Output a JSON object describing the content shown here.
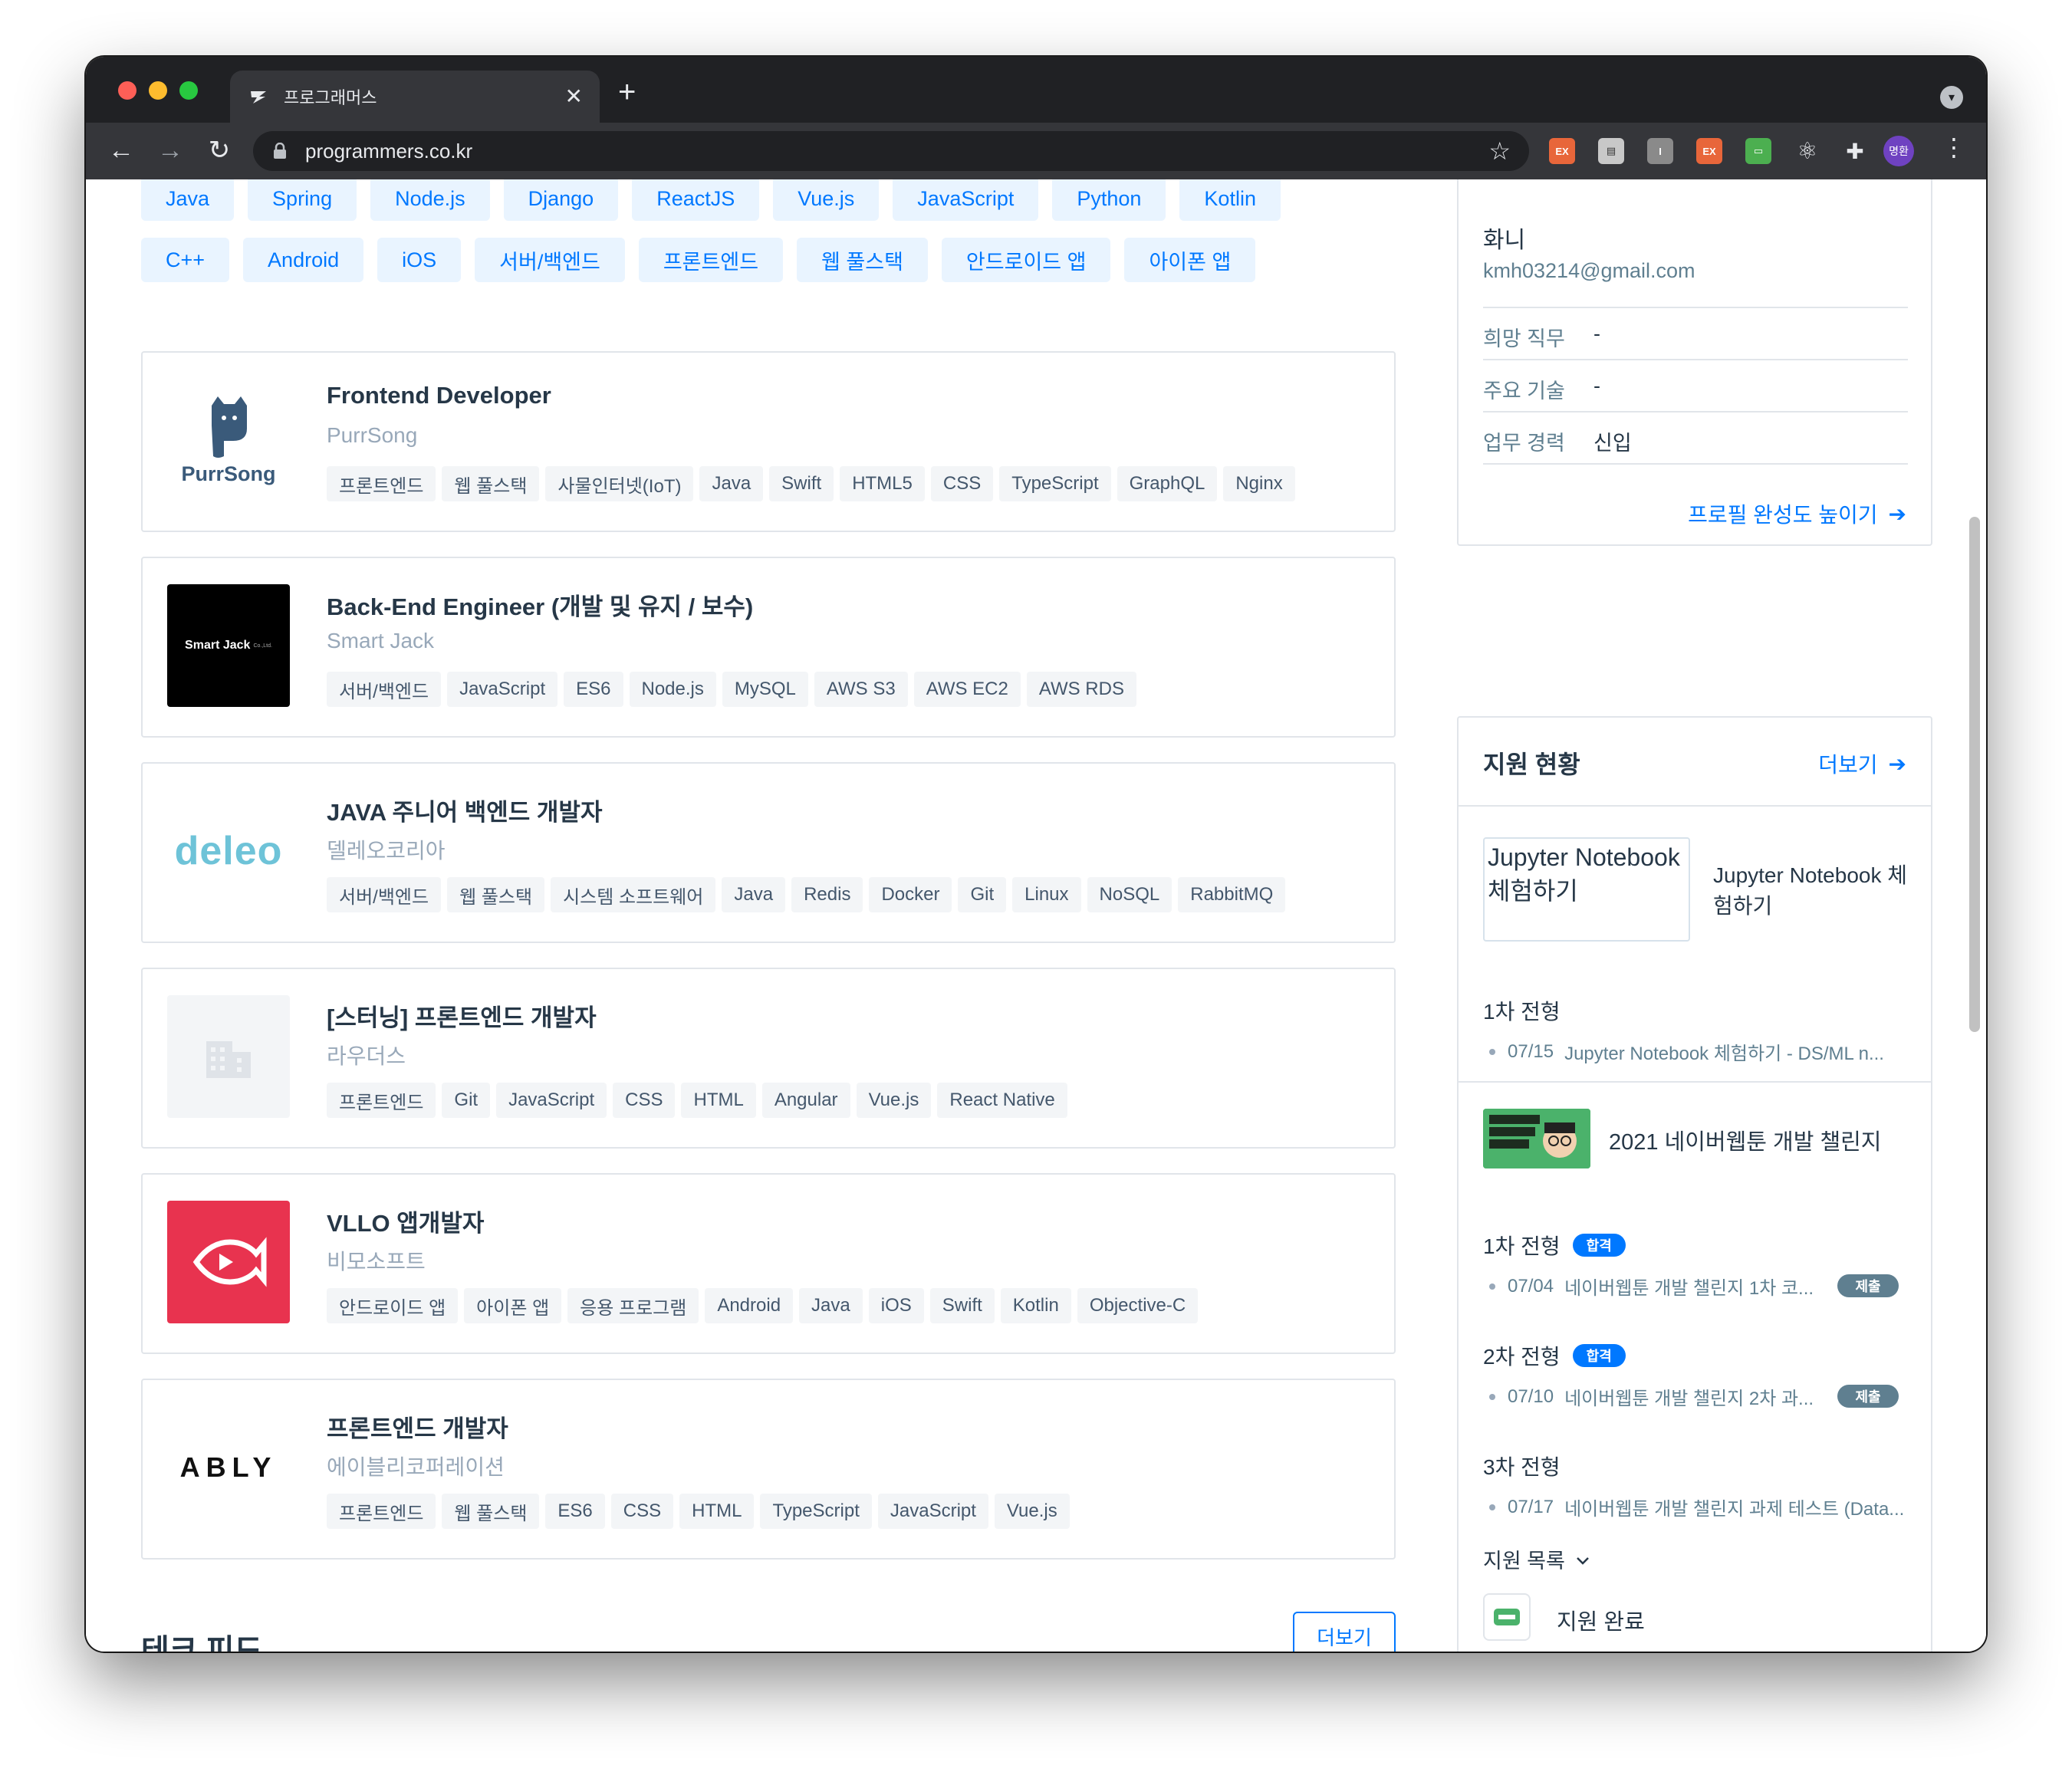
{
  "browser": {
    "tab_title": "프로그래머스",
    "url": "programmers.co.kr",
    "avatar_label": "명환",
    "extensions": [
      "EX",
      "folder",
      "I",
      "EX",
      "screen",
      "react",
      "puzzle"
    ]
  },
  "chip_rows": [
    [
      "Java",
      "Spring",
      "Node.js",
      "Django",
      "ReactJS",
      "Vue.js",
      "JavaScript",
      "Python",
      "Kotlin"
    ],
    [
      "C++",
      "Android",
      "iOS",
      "서버/백엔드",
      "프론트엔드",
      "웹 풀스택",
      "안드로이드 앱",
      "아이폰 앱"
    ]
  ],
  "jobs": [
    {
      "title": "Frontend Developer",
      "company": "PurrSong",
      "logo_text": "PurrSong",
      "tags": [
        "프론트엔드",
        "웹 풀스택",
        "사물인터넷(IoT)",
        "Java",
        "Swift",
        "HTML5",
        "CSS",
        "TypeScript",
        "GraphQL",
        "Nginx"
      ]
    },
    {
      "title": "Back-End Engineer (개발 및 유지 / 보수)",
      "company": "Smart Jack",
      "logo_text": "Smart Jack",
      "logo_sub": "Co.,Ltd.",
      "tags": [
        "서버/백엔드",
        "JavaScript",
        "ES6",
        "Node.js",
        "MySQL",
        "AWS S3",
        "AWS EC2",
        "AWS RDS"
      ]
    },
    {
      "title": "JAVA 주니어 백엔드 개발자",
      "company": "델레오코리아",
      "logo_text": "deleo",
      "tags": [
        "서버/백엔드",
        "웹 풀스택",
        "시스템 소프트웨어",
        "Java",
        "Redis",
        "Docker",
        "Git",
        "Linux",
        "NoSQL",
        "RabbitMQ"
      ]
    },
    {
      "title": "[스터닝] 프론트엔드 개발자",
      "company": "라우더스",
      "logo_text": "",
      "tags": [
        "프론트엔드",
        "Git",
        "JavaScript",
        "CSS",
        "HTML",
        "Angular",
        "Vue.js",
        "React Native"
      ]
    },
    {
      "title": "VLLO 앱개발자",
      "company": "비모소프트",
      "logo_text": "",
      "tags": [
        "안드로이드 앱",
        "아이폰 앱",
        "응용 프로그램",
        "Android",
        "Java",
        "iOS",
        "Swift",
        "Kotlin",
        "Objective-C"
      ]
    },
    {
      "title": "프론트엔드 개발자",
      "company": "에이블리코퍼레이션",
      "logo_text": "ABLY",
      "tags": [
        "프론트엔드",
        "웹 풀스택",
        "ES6",
        "CSS",
        "HTML",
        "TypeScript",
        "JavaScript",
        "Vue.js"
      ]
    }
  ],
  "tech_feed": {
    "title": "테크 피드",
    "more_label": "더보기"
  },
  "profile": {
    "name": "화니",
    "email": "kmh03214@gmail.com",
    "rows": [
      {
        "label": "희망 직무",
        "value": "-"
      },
      {
        "label": "주요 기술",
        "value": "-"
      },
      {
        "label": "업무 경력",
        "value": "신입"
      }
    ],
    "improve_link": "프로필 완성도 높이기"
  },
  "applications": {
    "title": "지원 현황",
    "more_label": "더보기",
    "jupyter": {
      "thumb_alt": "Jupyter Notebook 체험하기",
      "title": "Jupyter Notebook 체험하기",
      "stage": "1차 전형",
      "item_date": "07/15",
      "item_text": "Jupyter Notebook 체험하기 - DS/ML n..."
    },
    "naver": {
      "thumb_text": "네이버웹툰 개발 챌린지",
      "title": "2021 네이버웹툰 개발 챌린지",
      "stages": [
        {
          "name": "1차 전형",
          "badge": "합격",
          "date": "07/04",
          "text": "네이버웹툰 개발 챌린지 1차 코...",
          "status": "제출"
        },
        {
          "name": "2차 전형",
          "badge": "합격",
          "date": "07/10",
          "text": "네이버웹툰 개발 챌린지 2차 과...",
          "status": "제출"
        },
        {
          "name": "3차 전형",
          "badge": "",
          "date": "07/17",
          "text": "네이버웹툰 개발 챌린지 과제 테스트 (Data...",
          "status": ""
        }
      ]
    },
    "list_toggle": "지원 목록",
    "done_label": "지원 완료"
  },
  "colors": {
    "accent": "#0078ff",
    "chip_bg": "#e9f4ff",
    "tag_bg": "#f3f5f7",
    "border": "#e1e5ea"
  }
}
